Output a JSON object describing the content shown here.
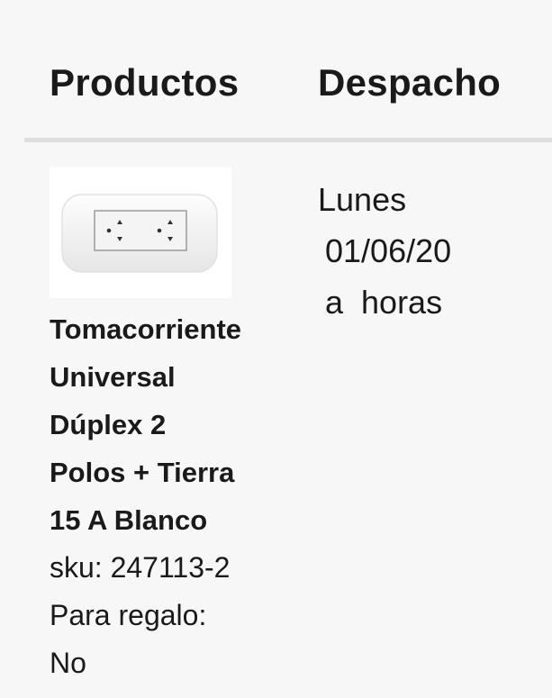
{
  "table": {
    "headers": {
      "products": "Productos",
      "dispatch": "Despacho"
    },
    "row": {
      "product": {
        "image_icon": "wall-outlet-duplex",
        "name_lines": [
          "Tomacorriente",
          "Universal",
          "Dúplex 2",
          "Polos + Tierra",
          "15 A Blanco"
        ],
        "sku": "sku: 247113-2",
        "gift_label": "Para regalo:",
        "gift_value": "No"
      },
      "dispatch": {
        "day": "Lunes",
        "date": "01/06/20",
        "time": "a  horas"
      }
    }
  }
}
